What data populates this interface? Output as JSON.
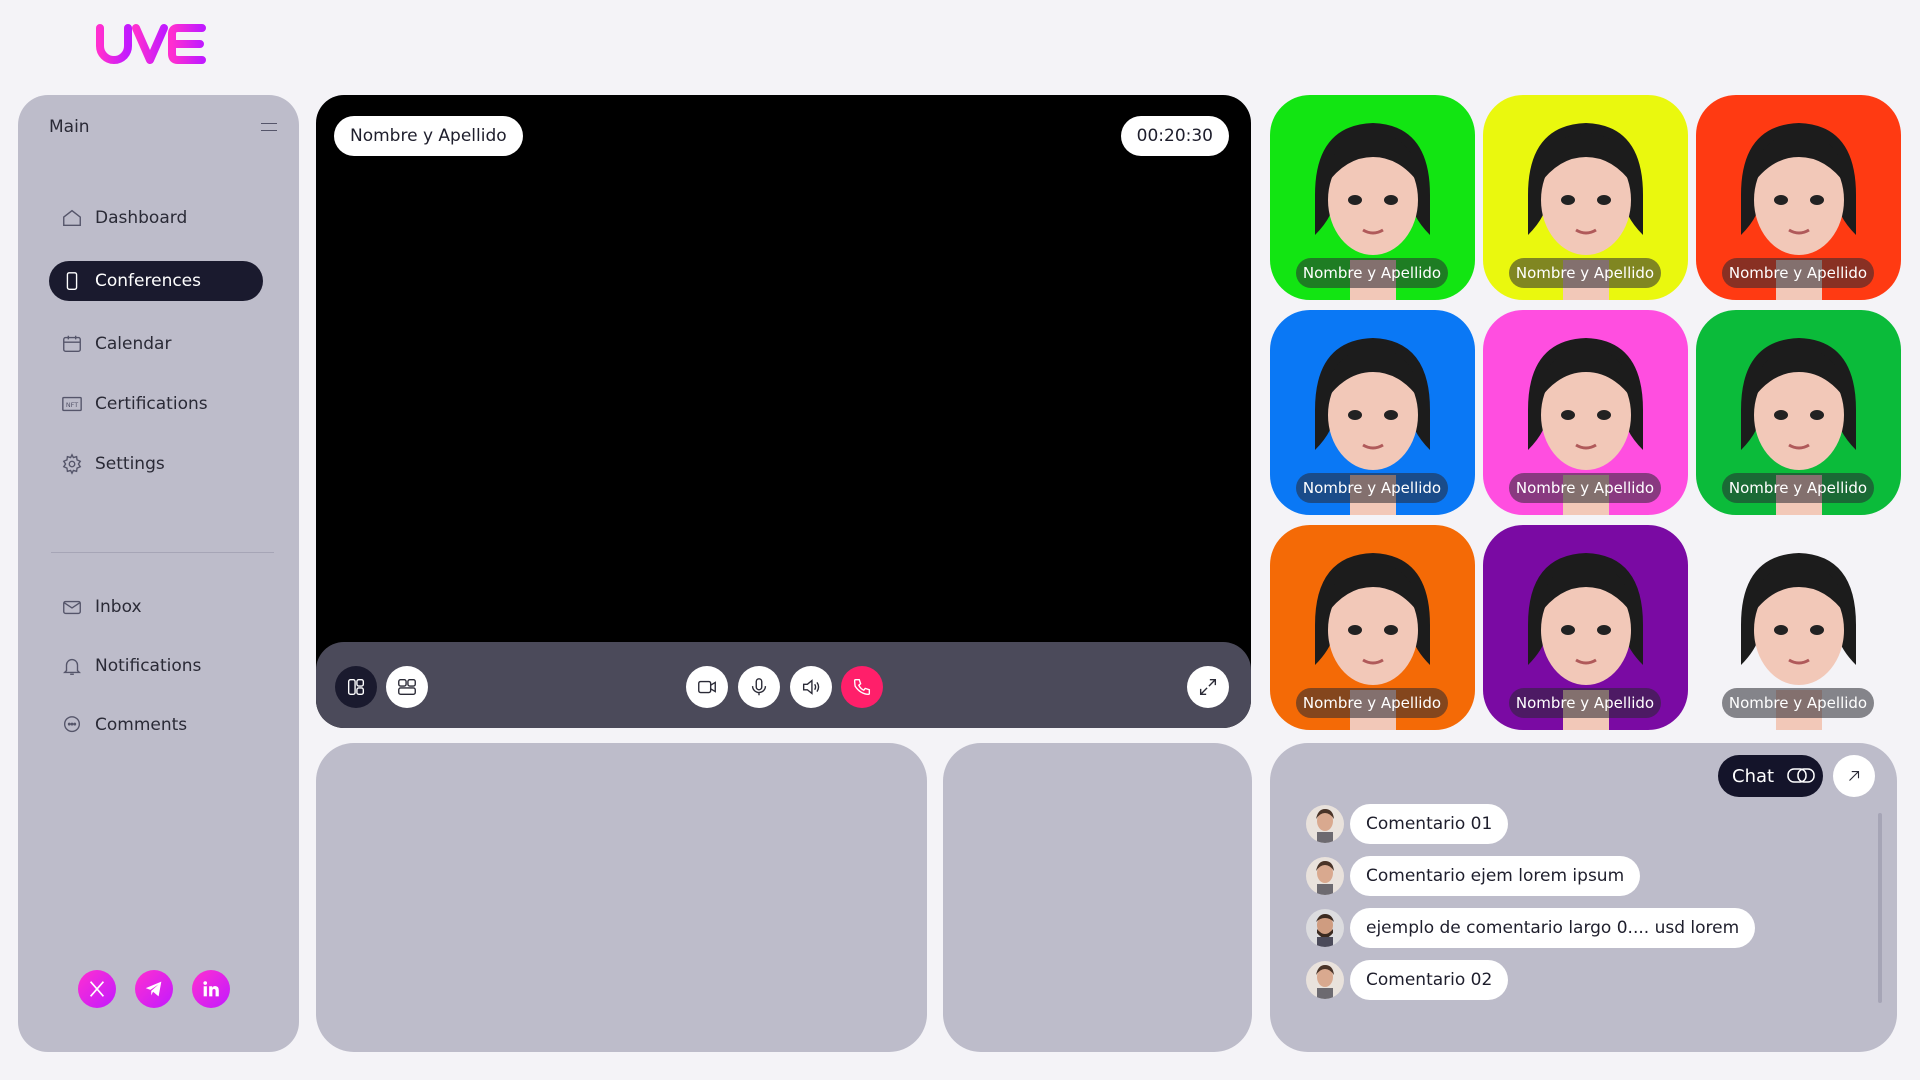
{
  "brand": {
    "logo_text": "UVE",
    "accent": "#e41fd6"
  },
  "sidebar": {
    "title": "Main",
    "items": [
      {
        "label": "Dashboard",
        "icon": "home-icon"
      },
      {
        "label": "Conferences",
        "icon": "phone-icon",
        "active": true
      },
      {
        "label": "Calendar",
        "icon": "calendar-icon"
      },
      {
        "label": "Certifications",
        "icon": "nft-icon"
      },
      {
        "label": "Settings",
        "icon": "gear-icon"
      }
    ],
    "secondary_items": [
      {
        "label": "Inbox",
        "icon": "mail-icon"
      },
      {
        "label": "Notifications",
        "icon": "bell-icon"
      },
      {
        "label": "Comments",
        "icon": "comment-icon"
      }
    ],
    "socials": [
      "x-icon",
      "telegram-icon",
      "linkedin-icon"
    ]
  },
  "stage": {
    "speaker_name": "Nombre y Apellido",
    "timer": "00:20:30"
  },
  "participants": [
    {
      "name": "Nombre y Apellido",
      "bg": "#12e512"
    },
    {
      "name": "Nombre y Apellido",
      "bg": "#eaf80e"
    },
    {
      "name": "Nombre y Apellido",
      "bg": "#ff3a12"
    },
    {
      "name": "Nombre y Apellido",
      "bg": "#0a78f5"
    },
    {
      "name": "Nombre y Apellido",
      "bg": "#ff4ee0"
    },
    {
      "name": "Nombre y Apellido",
      "bg": "#0bbb3a"
    },
    {
      "name": "Nombre y Apellido",
      "bg": "#f46a06"
    },
    {
      "name": "Nombre y Apellido",
      "bg": "#7a0aa3"
    },
    {
      "name": "Nombre y Apellido",
      "bg": "#f4f3f7"
    }
  ],
  "chat": {
    "button_label": "Chat",
    "comments": [
      {
        "text": "Comentario 01"
      },
      {
        "text": "Comentario ejem lorem ipsum"
      },
      {
        "text": "ejemplo de comentario largo 0.... usd lorem"
      },
      {
        "text": "Comentario 02"
      }
    ]
  }
}
